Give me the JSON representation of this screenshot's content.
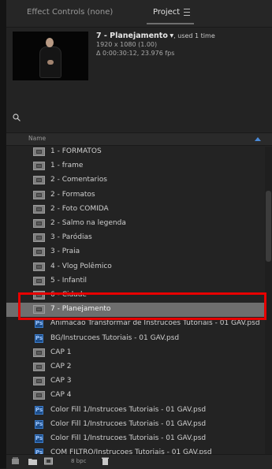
{
  "tabs": {
    "effect_controls": "Effect Controls (none)",
    "project": "Project"
  },
  "preview": {
    "name": "7 - Planejamento",
    "used": ", used 1 time",
    "resolution": "1920 x 1080 (1.00)",
    "duration": "Δ 0:00:30:12, 23.976 fps"
  },
  "search": {
    "value": ""
  },
  "columns": {
    "name": "Name"
  },
  "items": [
    {
      "label": "1 - FORMATOS",
      "type": "comp"
    },
    {
      "label": "1 - frame",
      "type": "comp"
    },
    {
      "label": "2 - Comentarios",
      "type": "comp"
    },
    {
      "label": "2 - Formatos",
      "type": "comp"
    },
    {
      "label": "2 - Foto COMIDA",
      "type": "comp"
    },
    {
      "label": "2 - Salmo na legenda",
      "type": "comp"
    },
    {
      "label": "3 - Paródias",
      "type": "comp"
    },
    {
      "label": "3 - Praia",
      "type": "comp"
    },
    {
      "label": "4 - Vlog Polêmico",
      "type": "comp"
    },
    {
      "label": "5 - Infantil",
      "type": "comp"
    },
    {
      "label": "6 - Cidade",
      "type": "comp"
    },
    {
      "label": "7 - Planejamento",
      "type": "comp",
      "selected": true
    },
    {
      "label": "Animacao Transformar de Instrucoes Tutoriais - 01 GAV.psd",
      "type": "psd"
    },
    {
      "label": "BG/Instrucoes Tutoriais - 01 GAV.psd",
      "type": "psd"
    },
    {
      "label": "CAP 1",
      "type": "comp"
    },
    {
      "label": "CAP 2",
      "type": "comp"
    },
    {
      "label": "CAP 3",
      "type": "comp"
    },
    {
      "label": "CAP 4",
      "type": "comp"
    },
    {
      "label": "Color Fill 1/Instrucoes Tutoriais - 01 GAV.psd",
      "type": "psd"
    },
    {
      "label": "Color Fill 1/Instrucoes Tutoriais - 01 GAV.psd",
      "type": "psd"
    },
    {
      "label": "Color Fill 1/Instrucoes Tutoriais - 01 GAV.psd",
      "type": "psd"
    },
    {
      "label": "COM FILTRO/Instrucoes Tutoriais - 01 GAV.psd",
      "type": "psd"
    }
  ],
  "footer": {
    "bpc": "8 bpc"
  },
  "colors": {
    "highlight": "#e80000",
    "selected_row": "#6e6e6e",
    "accent": "#4a8ad8"
  }
}
